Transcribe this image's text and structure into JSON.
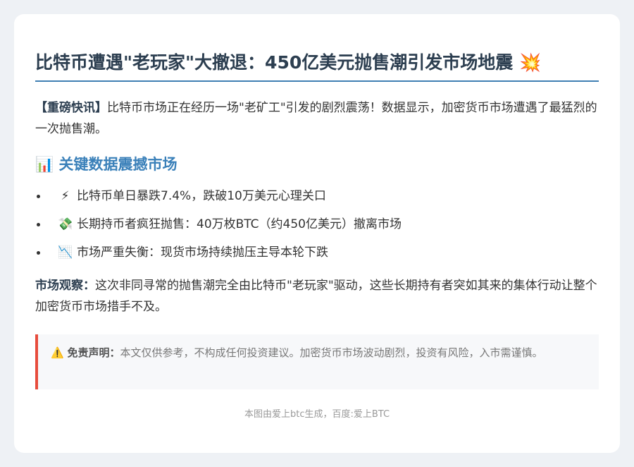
{
  "title": {
    "text": "比特币遭遇\"老玩家\"大撤退：450亿美元抛售潮引发市场地震",
    "emoji": "💥"
  },
  "intro": {
    "label": "【重磅快讯】",
    "text": "比特币市场正在经历一场\"老矿工\"引发的剧烈震荡！数据显示，加密货币市场遭遇了最猛烈的一次抛售潮。"
  },
  "section": {
    "emoji": "📊",
    "heading": "关键数据震撼市场"
  },
  "points": [
    {
      "emoji": "⚡",
      "text": "比特币单日暴跌7.4%，跌破10万美元心理关口"
    },
    {
      "emoji": "💸",
      "text": "长期持币者疯狂抛售：40万枚BTC（约450亿美元）撤离市场"
    },
    {
      "emoji": "📉",
      "text": "市场严重失衡：现货市场持续抛压主导本轮下跌"
    }
  ],
  "observation": {
    "label": "市场观察：",
    "text": "这次非同寻常的抛售潮完全由比特币\"老玩家\"驱动，这些长期持有者突如其来的集体行动让整个加密货币市场措手不及。"
  },
  "disclaimer": {
    "emoji": "⚠️",
    "label": "免责声明：",
    "text": "本文仅供参考，不构成任何投资建议。加密货币市场波动剧烈，投资有风险，入市需谨慎。"
  },
  "footer": {
    "text": "本图由爱上btc生成，百度:爱上BTC"
  },
  "colors": {
    "accent": "#3a80b9",
    "title": "#2c3e50",
    "warning": "#e74c3c"
  }
}
